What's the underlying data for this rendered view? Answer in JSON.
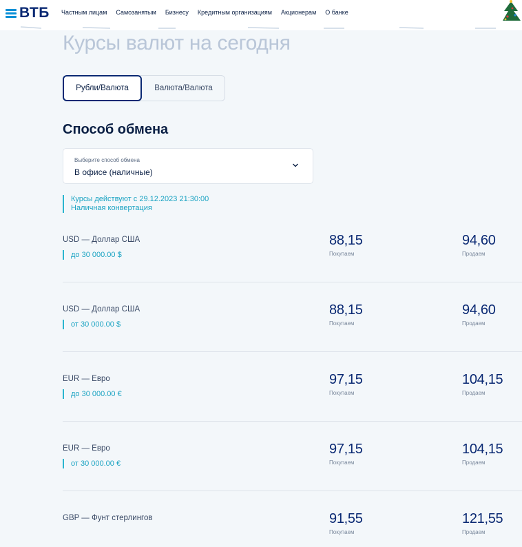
{
  "header": {
    "logo_text": "ВТБ",
    "nav": [
      "Частным лицам",
      "Самозанятым",
      "Бизнесу",
      "Кредитным организациям",
      "Акционерам",
      "О банке"
    ]
  },
  "page": {
    "title": "Курсы валют на сегодня",
    "tabs": [
      {
        "label": "Рубли/Валюта",
        "active": true
      },
      {
        "label": "Валюта/Валюта",
        "active": false
      }
    ],
    "section_title": "Способ обмена",
    "select": {
      "label": "Выберите способ обмена",
      "value": "В офисе (наличные)"
    },
    "note": {
      "line1": "Курсы действуют с 29.12.2023 21:30:00",
      "line2": "Наличная конвертация"
    }
  },
  "rates": [
    {
      "currency": "USD — Доллар США",
      "limit": "до 30 000.00 $",
      "buy": "88,15",
      "buy_caption": "Покупаем",
      "sell": "94,60",
      "sell_caption": "Продаем"
    },
    {
      "currency": "USD — Доллар США",
      "limit": "от 30 000.00 $",
      "buy": "88,15",
      "buy_caption": "Покупаем",
      "sell": "94,60",
      "sell_caption": "Продаем"
    },
    {
      "currency": "EUR — Евро",
      "limit": "до 30 000.00 €",
      "buy": "97,15",
      "buy_caption": "Покупаем",
      "sell": "104,15",
      "sell_caption": "Продаем"
    },
    {
      "currency": "EUR — Евро",
      "limit": "от 30 000.00 €",
      "buy": "97,15",
      "buy_caption": "Покупаем",
      "sell": "104,15",
      "sell_caption": "Продаем"
    },
    {
      "currency": "GBP — Фунт стерлингов",
      "limit": "",
      "buy": "91,55",
      "buy_caption": "Покупаем",
      "sell": "121,55",
      "sell_caption": "Продаем"
    }
  ],
  "colors": {
    "brand": "#0a2973",
    "accent": "#2bb5cf",
    "background": "#f3f7fa"
  },
  "icons": [
    "vtb-logo",
    "chevron-down-icon",
    "christmas-tree-icon"
  ]
}
